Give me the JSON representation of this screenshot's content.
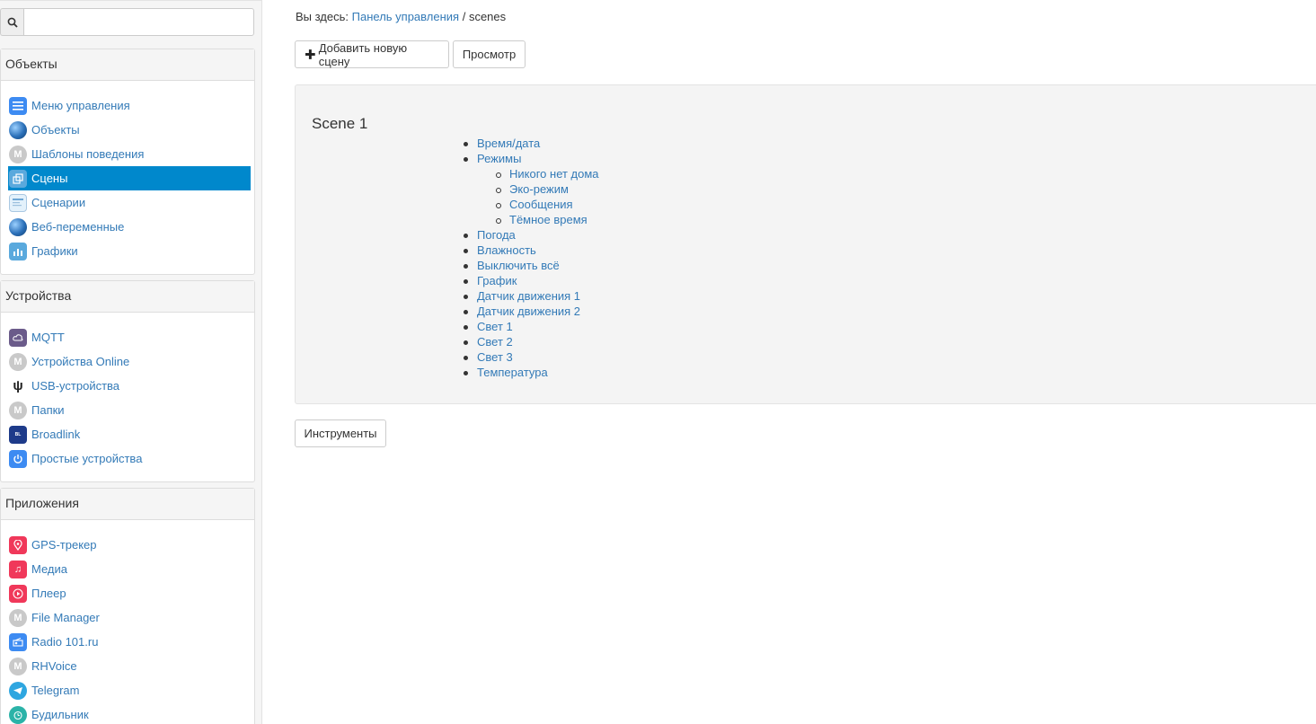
{
  "search": {
    "placeholder": "",
    "value": ""
  },
  "sidebar": {
    "groups": [
      {
        "title": "Объекты",
        "items": [
          {
            "label": "Меню управления",
            "icon": "menu-icon"
          },
          {
            "label": "Объекты",
            "icon": "globe-icon"
          },
          {
            "label": "Шаблоны поведения",
            "icon": "module-icon"
          },
          {
            "label": "Сцены",
            "icon": "scenes-icon",
            "active": true
          },
          {
            "label": "Сценарии",
            "icon": "scripts-icon"
          },
          {
            "label": "Веб-переменные",
            "icon": "web-globe-icon"
          },
          {
            "label": "Графики",
            "icon": "chart-icon"
          }
        ]
      },
      {
        "title": "Устройства",
        "items": [
          {
            "label": "MQTT",
            "icon": "mqtt-icon"
          },
          {
            "label": "Устройства Online",
            "icon": "module-icon"
          },
          {
            "label": "USB-устройства",
            "icon": "usb-icon"
          },
          {
            "label": "Папки",
            "icon": "module-icon"
          },
          {
            "label": "Broadlink",
            "icon": "broadlink-icon"
          },
          {
            "label": "Простые устройства",
            "icon": "power-icon"
          }
        ]
      },
      {
        "title": "Приложения",
        "items": [
          {
            "label": "GPS-трекер",
            "icon": "gps-icon"
          },
          {
            "label": "Медиа",
            "icon": "music-icon"
          },
          {
            "label": "Плеер",
            "icon": "play-icon"
          },
          {
            "label": "File Manager",
            "icon": "module-icon"
          },
          {
            "label": "Radio 101.ru",
            "icon": "radio-icon"
          },
          {
            "label": "RHVoice",
            "icon": "module-icon"
          },
          {
            "label": "Telegram",
            "icon": "telegram-icon"
          },
          {
            "label": "Будильник",
            "icon": "alarm-icon"
          }
        ]
      }
    ]
  },
  "breadcrumb": {
    "prefix": "Вы здесь:",
    "link": "Панель управления",
    "separator": "/",
    "current": "scenes"
  },
  "toolbar": {
    "add_label": "Добавить новую сцену",
    "view_label": "Просмотр"
  },
  "scene": {
    "title": "Scene 1",
    "items": [
      {
        "label": "Время/дата"
      },
      {
        "label": "Режимы",
        "children": [
          "Никого нет дома",
          "Эко-режим",
          "Сообщения",
          "Тёмное время"
        ]
      },
      {
        "label": "Погода"
      },
      {
        "label": "Влажность"
      },
      {
        "label": "Выключить всё"
      },
      {
        "label": "График"
      },
      {
        "label": "Датчик движения 1"
      },
      {
        "label": "Датчик движения 2"
      },
      {
        "label": "Свет 1"
      },
      {
        "label": "Свет 2"
      },
      {
        "label": "Свет 3"
      },
      {
        "label": "Температура"
      }
    ]
  },
  "tools": {
    "label": "Инструменты"
  },
  "colors": {
    "link": "#337ab7",
    "active_bg": "#0088cc",
    "panel_bg": "#f4f4f4"
  }
}
